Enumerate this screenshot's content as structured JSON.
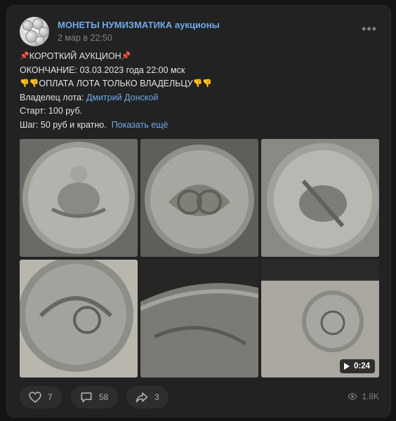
{
  "post": {
    "group_name": "МОНЕТЫ НУМИЗМАТИКА аукционы",
    "time": "2 мар в 22:50",
    "menu_icon": "more-horizontal-icon",
    "menu_glyph": "•••",
    "lines": {
      "title": "КОРОТКИЙ АУКЦИОН",
      "end": "ОКОНЧАНИЕ: 03.03.2023 года 22:00 мск",
      "payment": "ОПЛАТА ЛОТА ТОЛЬКО ВЛАДЕЛЬЦУ",
      "owner_label": "Владелец лота: ",
      "owner_name": "Дмитрий Донской",
      "start": "Старт: 100 руб.",
      "step": "Шаг: 50 руб и кратно.",
      "show_more": "Показать ещё"
    },
    "emoji": {
      "pin": "📌",
      "thumb": "👎"
    },
    "media": {
      "video_duration": "0:24"
    },
    "actions": {
      "likes": "7",
      "comments": "58",
      "shares": "3",
      "views": "1.8K"
    }
  }
}
